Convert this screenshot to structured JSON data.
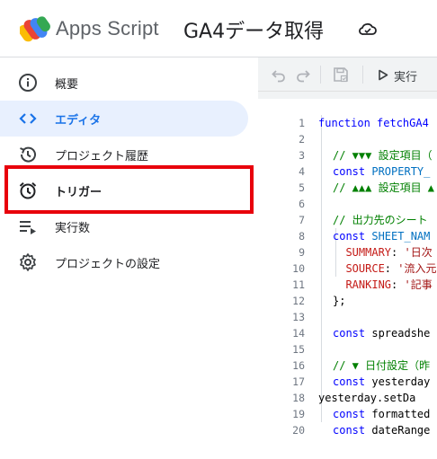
{
  "header": {
    "app_name": "Apps Script",
    "project_title": "GA4データ取得"
  },
  "sidebar": {
    "items": [
      {
        "label": "概要",
        "icon": "info-icon",
        "active": false
      },
      {
        "label": "エディタ",
        "icon": "code-brackets-icon",
        "active": true
      },
      {
        "label": "プロジェクト履歴",
        "icon": "history-icon",
        "active": false
      },
      {
        "label": "トリガー",
        "icon": "alarm-clock-icon",
        "active": false,
        "highlighted": true
      },
      {
        "label": "実行数",
        "icon": "executions-list-icon",
        "active": false
      },
      {
        "label": "プロジェクトの設定",
        "icon": "gear-icon",
        "active": false
      }
    ]
  },
  "toolbar": {
    "run_label": "実行"
  },
  "code": {
    "line_numbers": [
      "1",
      "2",
      "3",
      "4",
      "5",
      "6",
      "7",
      "8",
      "9",
      "10",
      "11",
      "12",
      "13",
      "14",
      "15",
      "16",
      "17",
      "18",
      "19",
      "20"
    ],
    "lines": [
      {
        "parts": [
          {
            "t": "function fetchGA4",
            "c": "kw"
          }
        ]
      },
      {
        "parts": []
      },
      {
        "parts": [
          {
            "t": "// ▼▼▼ 設定項目（",
            "c": "cm"
          }
        ]
      },
      {
        "parts": [
          {
            "t": "const ",
            "c": "kw"
          },
          {
            "t": "PROPERTY_",
            "c": "cn"
          }
        ]
      },
      {
        "parts": [
          {
            "t": "// ▲▲▲ 設定項目 ▲",
            "c": "cm"
          }
        ]
      },
      {
        "parts": []
      },
      {
        "parts": [
          {
            "t": "// 出力先のシート",
            "c": "cm"
          }
        ]
      },
      {
        "parts": [
          {
            "t": "const ",
            "c": "kw"
          },
          {
            "t": "SHEET_NAM",
            "c": "cn"
          }
        ]
      },
      {
        "parts": [
          {
            "t": "  SUMMARY",
            "c": "key"
          },
          {
            "t": ": ",
            "c": "pl"
          },
          {
            "t": "'日次",
            "c": "str"
          }
        ]
      },
      {
        "parts": [
          {
            "t": "  SOURCE",
            "c": "key"
          },
          {
            "t": ": ",
            "c": "pl"
          },
          {
            "t": "'流入元",
            "c": "str"
          }
        ]
      },
      {
        "parts": [
          {
            "t": "  RANKING",
            "c": "key"
          },
          {
            "t": ": ",
            "c": "pl"
          },
          {
            "t": "'記事",
            "c": "str"
          }
        ]
      },
      {
        "parts": [
          {
            "t": "};",
            "c": "pl"
          }
        ]
      },
      {
        "parts": []
      },
      {
        "parts": [
          {
            "t": "const ",
            "c": "kw"
          },
          {
            "t": "spreadshe",
            "c": "pl"
          }
        ]
      },
      {
        "parts": []
      },
      {
        "parts": [
          {
            "t": "// ▼ 日付設定（昨",
            "c": "cm"
          }
        ]
      },
      {
        "parts": [
          {
            "t": "const ",
            "c": "kw"
          },
          {
            "t": "yesterday",
            "c": "pl"
          }
        ]
      },
      {
        "parts": [
          {
            "t": "yesterday.setDa",
            "c": "pl"
          }
        ]
      },
      {
        "parts": [
          {
            "t": "const ",
            "c": "kw"
          },
          {
            "t": "formatted",
            "c": "pl"
          }
        ]
      },
      {
        "parts": [
          {
            "t": "const ",
            "c": "kw"
          },
          {
            "t": "dateRange",
            "c": "pl"
          }
        ]
      }
    ]
  }
}
